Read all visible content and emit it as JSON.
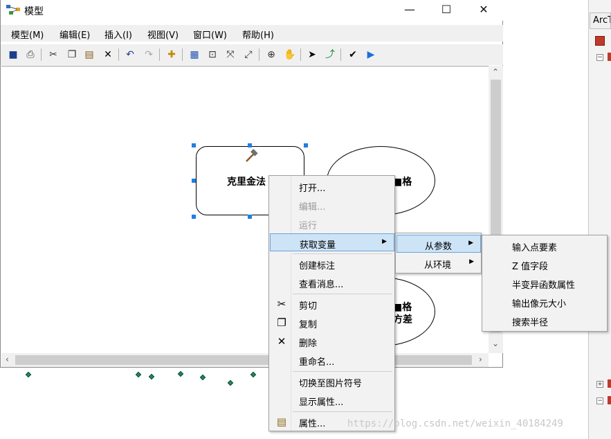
{
  "window": {
    "title": "模型",
    "controls": {
      "minimize": "—",
      "maximize": "☐",
      "close": "✕"
    }
  },
  "menubar": {
    "items": [
      "模型(M)",
      "编辑(E)",
      "插入(I)",
      "视图(V)",
      "窗口(W)",
      "帮助(H)"
    ]
  },
  "toolbar": {
    "icons": [
      "save-icon",
      "print-icon",
      "cut-icon",
      "copy-icon",
      "paste-icon",
      "delete-icon",
      "undo-icon",
      "redo-icon",
      "add-data-icon",
      "auto-layout-icon",
      "full-extent-icon",
      "fixed-zoom-in-icon",
      "fixed-zoom-out-icon",
      "zoom-in-icon",
      "pan-icon",
      "select-icon",
      "connect-icon",
      "validate-icon",
      "run-icon"
    ]
  },
  "diagram": {
    "tool_node": "克里金法",
    "ellipse1_label": "■格",
    "ellipse2_label_top": "■格",
    "ellipse2_label_bottom": "方差"
  },
  "context_menu": {
    "items": [
      {
        "label": "打开...",
        "enabled": true
      },
      {
        "label": "编辑...",
        "enabled": false
      },
      {
        "label": "运行",
        "enabled": false
      },
      {
        "label": "获取变量",
        "enabled": true,
        "submenu": true
      },
      {
        "label": "创建标注",
        "enabled": true
      },
      {
        "label": "查看消息...",
        "enabled": true
      },
      {
        "label": "剪切",
        "enabled": true,
        "icon": "cut-icon"
      },
      {
        "label": "复制",
        "enabled": true,
        "icon": "copy-icon"
      },
      {
        "label": "删除",
        "enabled": true,
        "icon": "delete-icon"
      },
      {
        "label": "重命名...",
        "enabled": true
      },
      {
        "label": "切换至图片符号",
        "enabled": true
      },
      {
        "label": "显示属性...",
        "enabled": true
      },
      {
        "label": "属性...",
        "enabled": true,
        "icon": "properties-icon"
      }
    ]
  },
  "submenu1": {
    "items": [
      {
        "label": "从参数",
        "submenu": true
      },
      {
        "label": "从环境",
        "submenu": true
      }
    ]
  },
  "submenu2": {
    "items": [
      "输入点要素",
      "Z 值字段",
      "半变异函数属性",
      "输出像元大小",
      "搜索半径"
    ]
  },
  "right_panel": {
    "tab": "ArcT"
  },
  "watermark": "https://blog.csdn.net/weixin_40184249"
}
